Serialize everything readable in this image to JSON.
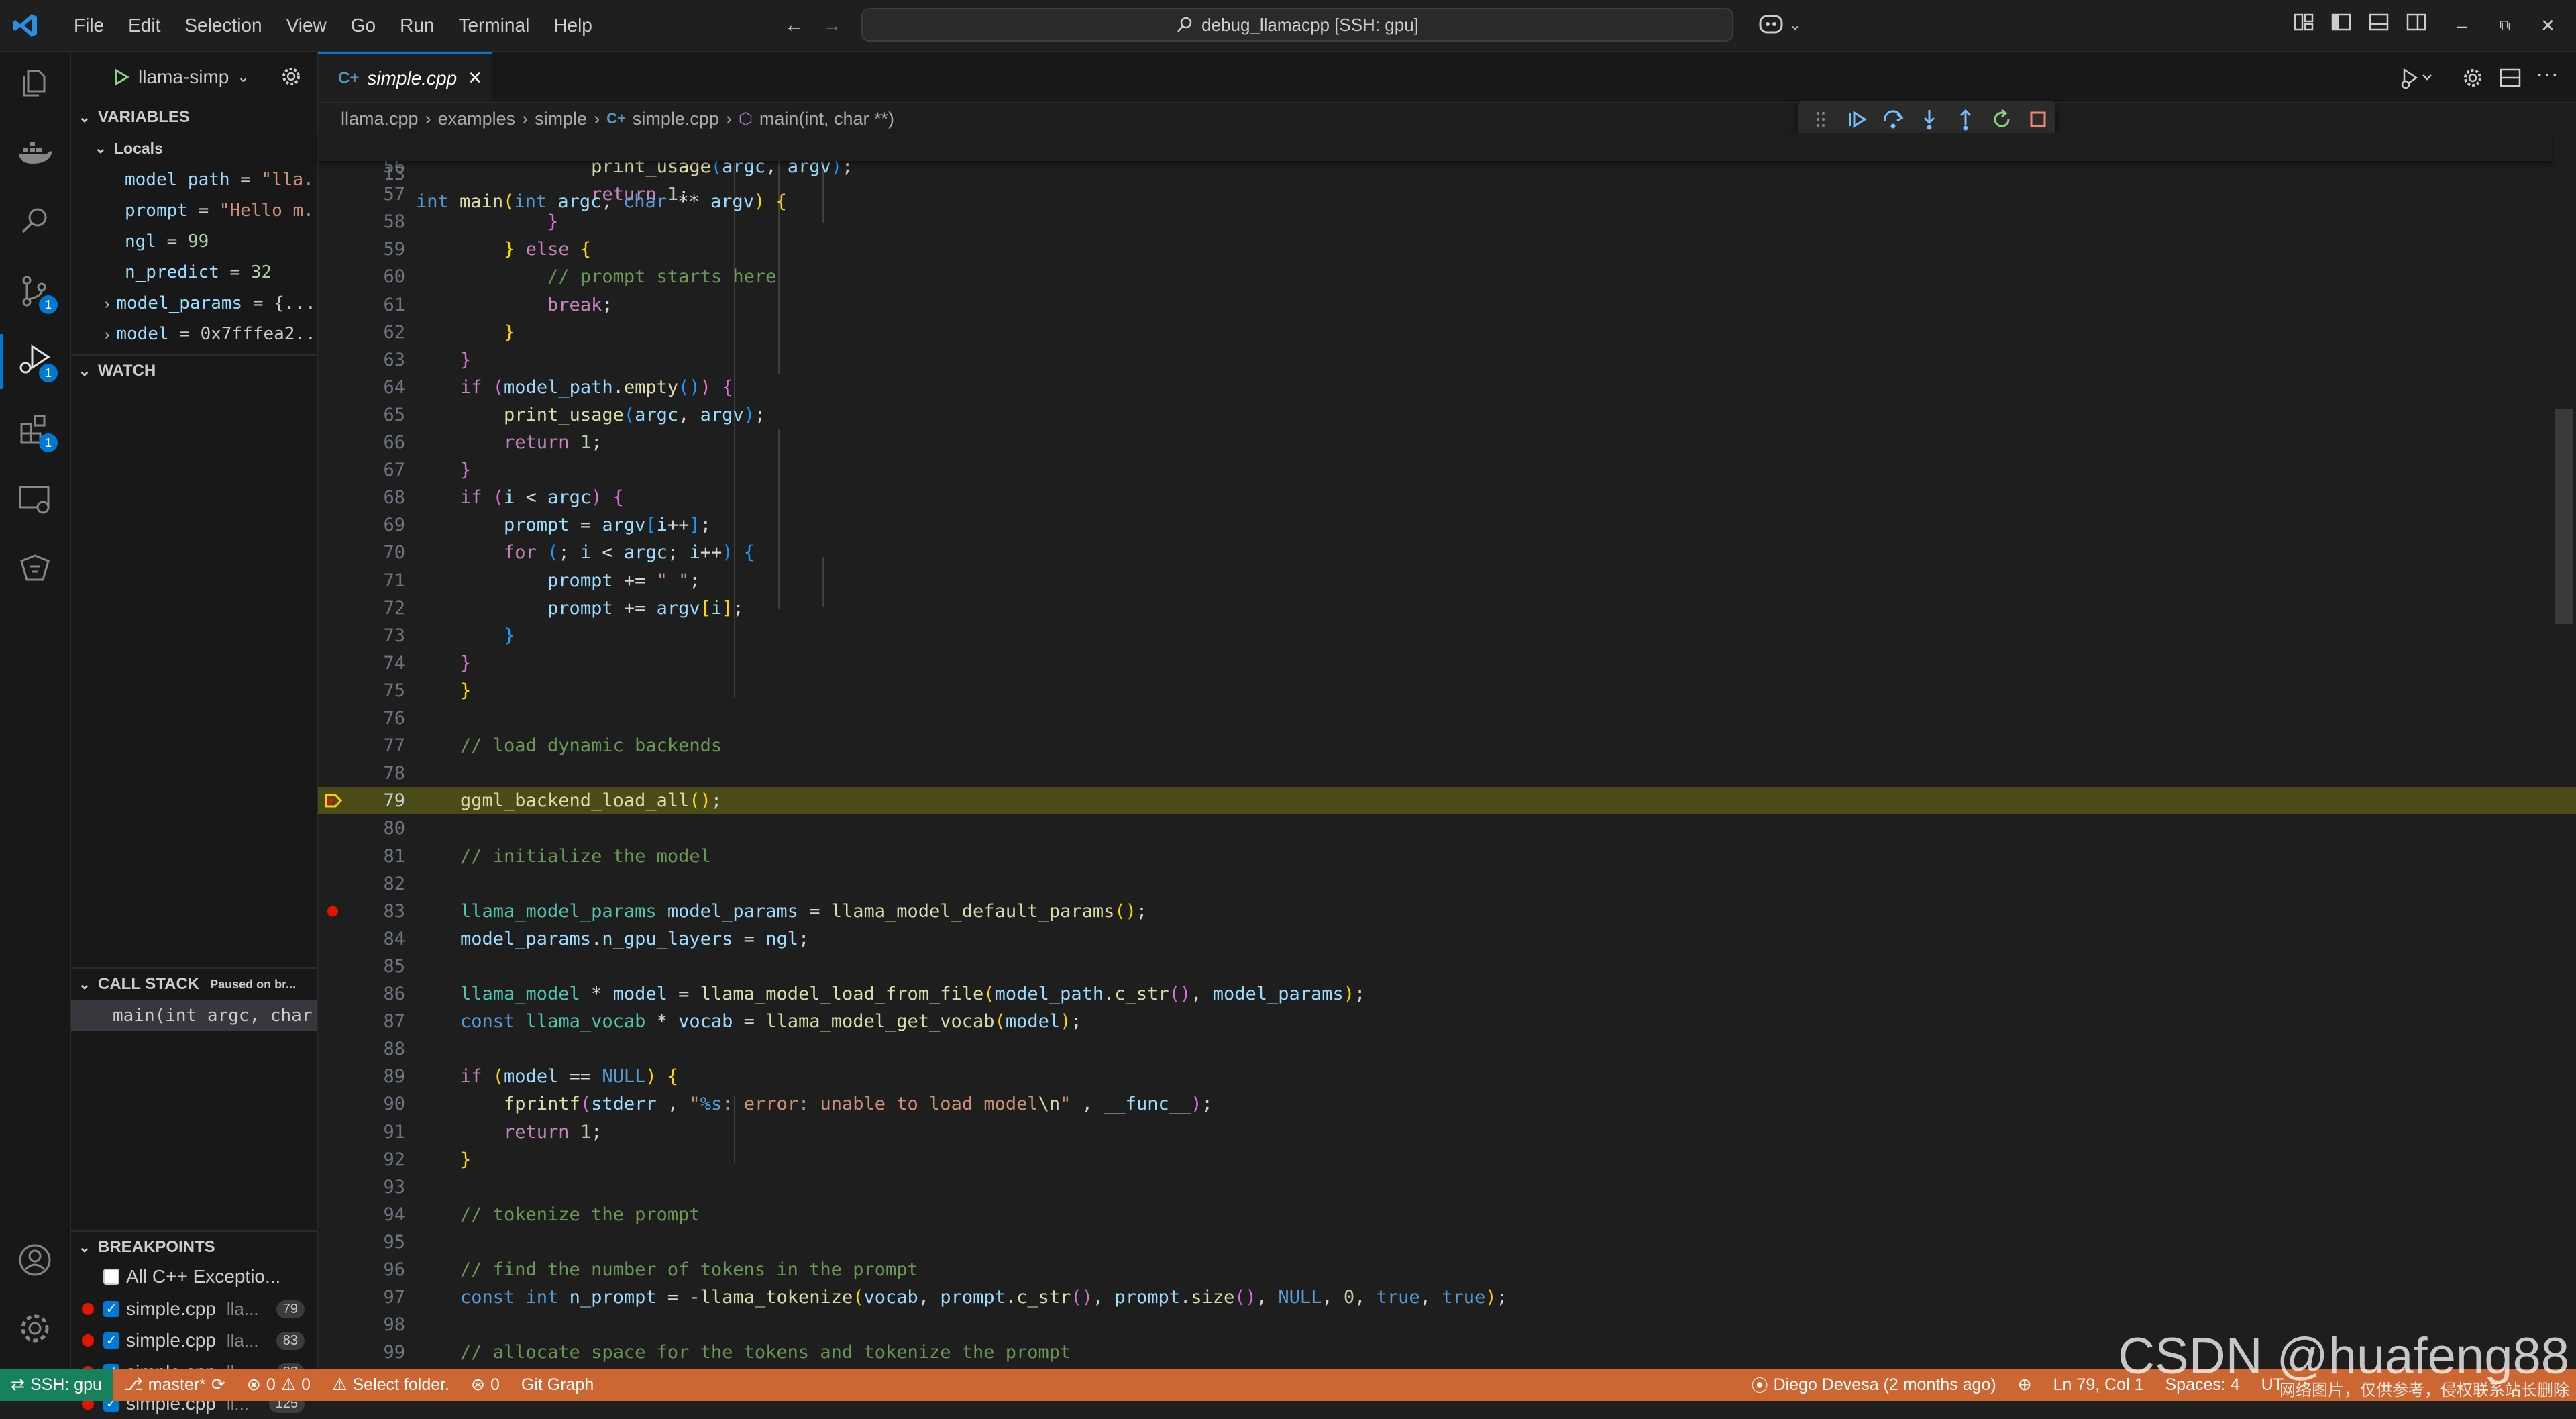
{
  "menu": [
    "File",
    "Edit",
    "Selection",
    "View",
    "Go",
    "Run",
    "Terminal",
    "Help"
  ],
  "command_center": "debug_llamacpp [SSH: gpu]",
  "activity_badges": {
    "source_control": "1",
    "run_debug": "1",
    "extensions": "1"
  },
  "debug_config": "llama-simp",
  "sections": {
    "variables": "VARIABLES",
    "locals": "Locals",
    "watch": "WATCH",
    "call_stack": "CALL STACK",
    "call_stack_status": "Paused on br...",
    "breakpoints": "BREAKPOINTS"
  },
  "locals": [
    {
      "name": "model_path",
      "value": "\"lla..."
    },
    {
      "name": "prompt",
      "value": "\"Hello m..."
    },
    {
      "name": "ngl",
      "value": "99"
    },
    {
      "name": "n_predict",
      "value": "32"
    },
    {
      "name": "model_params",
      "value": "{..."
    },
    {
      "name": "model",
      "value": "0x7fffea2..."
    }
  ],
  "call_stack_frame": "main(int argc, char",
  "breakpoints": [
    {
      "label": "All C++ Exceptio...",
      "path": "",
      "line": ""
    },
    {
      "label": "simple.cpp",
      "path": "lla...",
      "line": "79"
    },
    {
      "label": "simple.cpp",
      "path": "lla...",
      "line": "83"
    },
    {
      "label": "simple.cpp",
      "path": "lla...",
      "line": "83"
    },
    {
      "label": "simple.cpp",
      "path": "ll...",
      "line": "125"
    }
  ],
  "tab": {
    "label": "simple.cpp"
  },
  "breadcrumb": [
    "llama.cpp",
    "examples",
    "simple",
    "simple.cpp",
    "main(int, char **)"
  ],
  "sticky": {
    "line": "13"
  },
  "current_line": "79",
  "code_start_line": 56,
  "status": {
    "remote": "SSH: gpu",
    "branch": "master*",
    "errors": "0",
    "warnings": "0",
    "select_folder": "Select folder.",
    "ports": "0",
    "git_graph": "Git Graph",
    "blame": "Diego Devesa (2 months ago)",
    "position": "Ln 79, Col 1",
    "spaces": "Spaces: 4",
    "encoding": "UT"
  },
  "watermark": "CSDN @huafeng88",
  "watermark_note": "网络图片，仅供参考，侵权联系站长删除"
}
